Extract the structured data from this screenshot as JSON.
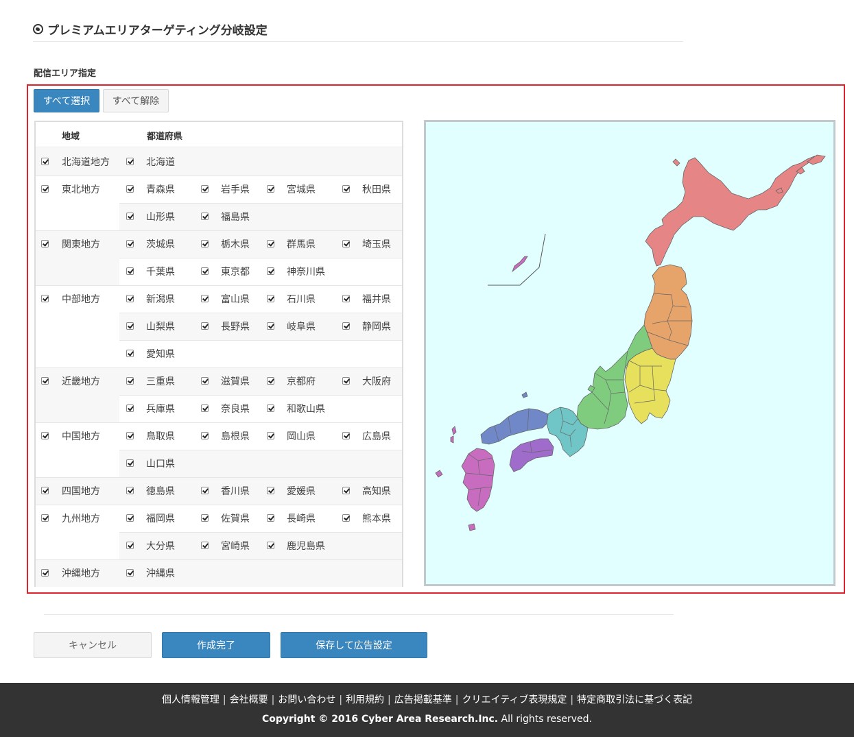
{
  "page": {
    "title": "プレミアムエリアターゲティング分岐設定",
    "section_label": "配信エリア指定"
  },
  "controls": {
    "select_all": "すべて選択",
    "deselect_all": "すべて解除"
  },
  "table": {
    "header_region": "地域",
    "header_prefecture": "都道府県"
  },
  "regions": [
    {
      "name": "北海道地方",
      "checked": true,
      "prefectures": [
        "北海道"
      ]
    },
    {
      "name": "東北地方",
      "checked": true,
      "prefectures": [
        "青森県",
        "岩手県",
        "宮城県",
        "秋田県",
        "山形県",
        "福島県"
      ]
    },
    {
      "name": "関東地方",
      "checked": true,
      "prefectures": [
        "茨城県",
        "栃木県",
        "群馬県",
        "埼玉県",
        "千葉県",
        "東京都",
        "神奈川県"
      ]
    },
    {
      "name": "中部地方",
      "checked": true,
      "prefectures": [
        "新潟県",
        "富山県",
        "石川県",
        "福井県",
        "山梨県",
        "長野県",
        "岐阜県",
        "静岡県",
        "愛知県"
      ]
    },
    {
      "name": "近畿地方",
      "checked": true,
      "prefectures": [
        "三重県",
        "滋賀県",
        "京都府",
        "大阪府",
        "兵庫県",
        "奈良県",
        "和歌山県"
      ]
    },
    {
      "name": "中国地方",
      "checked": true,
      "prefectures": [
        "鳥取県",
        "島根県",
        "岡山県",
        "広島県",
        "山口県"
      ]
    },
    {
      "name": "四国地方",
      "checked": true,
      "prefectures": [
        "徳島県",
        "香川県",
        "愛媛県",
        "高知県"
      ]
    },
    {
      "name": "九州地方",
      "checked": true,
      "prefectures": [
        "福岡県",
        "佐賀県",
        "長崎県",
        "熊本県",
        "大分県",
        "宮崎県",
        "鹿児島県"
      ]
    },
    {
      "name": "沖縄地方",
      "checked": true,
      "prefectures": [
        "沖縄県"
      ]
    }
  ],
  "map": {
    "background": "#e1ffff",
    "region_colors": {
      "hokkaido": "#e68585",
      "tohoku": "#e6a46b",
      "kanto": "#e6e05c",
      "chubu": "#7fcc7f",
      "kinki": "#70c6c6",
      "chugoku": "#7088c8",
      "shikoku": "#a06ccc",
      "kyushu": "#c86cc0"
    }
  },
  "actions": {
    "cancel": "キャンセル",
    "complete": "作成完了",
    "save_and_ad": "保存して広告設定"
  },
  "footer": {
    "links": [
      "個人情報管理",
      "会社概要",
      "お問い合わせ",
      "利用規約",
      "広告掲載基準",
      "クリエイティブ表現規定",
      "特定商取引法に基づく表記"
    ],
    "copyright_bold": "Copyright © 2016 Cyber Area Research.Inc.",
    "copyright_rest": " All rights reserved."
  },
  "colors": {
    "accent": "#3a86be",
    "frame": "#e0212b",
    "footer_bg": "#333333"
  }
}
